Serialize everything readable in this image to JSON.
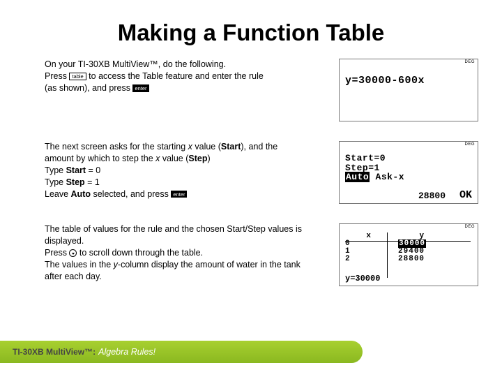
{
  "title": "Making a Function Table",
  "step1": {
    "line1a": "On your TI-30XB MultiView™, do the following.",
    "line2a": "Press ",
    "key_table": "table",
    "line2b": " to access the Table feature and enter the rule",
    "line3a": "(as shown), and press ",
    "key_enter": "enter"
  },
  "step2": {
    "p1": "The next screen asks for the starting ",
    "p2": " value (",
    "p3": "Start",
    "p4": "), and the amount by which to step the ",
    "p5": " value (",
    "p6": "Step",
    "p7": ")",
    "t1a": "Type ",
    "t1b": "Start",
    "t1c": " = 0",
    "t2a": "Type ",
    "t2b": "Step",
    "t2c": " = 1",
    "t3a": "Leave ",
    "t3b": "Auto",
    "t3c": " selected, and press "
  },
  "step3": {
    "p1": "The table of values for the rule and the chosen Start/Step values is displayed.",
    "p2a": "Press ",
    "p2b": " to scroll down through the table.",
    "p3a": "The values in the ",
    "p3b": "-column display the amount of water in the tank after each day."
  },
  "italic_x": "x",
  "italic_y": "y",
  "deg": "DEG",
  "screen1": {
    "eq": "y=30000-600x"
  },
  "screen2": {
    "l1": "Start=0",
    "l2": "Step=1",
    "auto": "Auto",
    "ask": "  Ask-x",
    "num": "28800",
    "ok": "OK"
  },
  "screen3": {
    "hx": "x",
    "hy": "y",
    "rows": [
      {
        "x": "0",
        "y": "30000"
      },
      {
        "x": "1",
        "y": "29400"
      },
      {
        "x": "2",
        "y": "28800"
      }
    ],
    "bottom": "y=30000"
  },
  "footer": {
    "model": "TI-30XB MultiView™:",
    "tag": " Algebra Rules!"
  }
}
